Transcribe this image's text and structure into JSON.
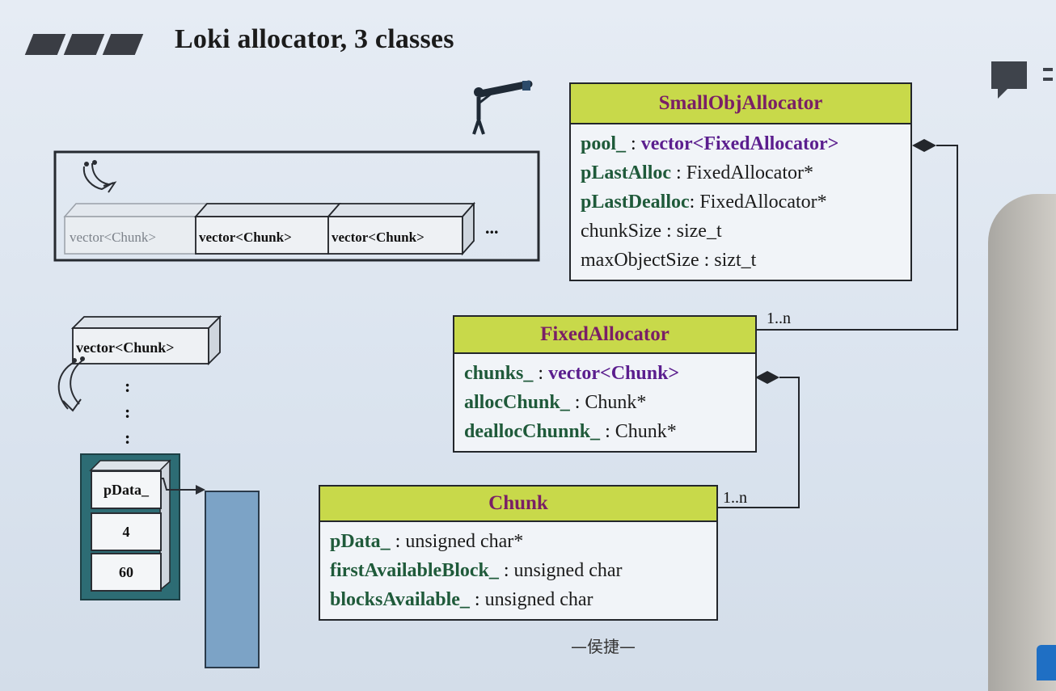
{
  "slide": {
    "title": "Loki allocator, 3 classes",
    "author_mark": "—侯捷—"
  },
  "classes": {
    "small_obj_allocator": {
      "name": "SmallObjAllocator",
      "attributes": [
        {
          "name": "pool_",
          "sep": " : ",
          "type": "vector<FixedAllocator>"
        },
        {
          "name": "pLastAlloc",
          "sep": " : ",
          "type": "FixedAllocator*"
        },
        {
          "name": "pLastDealloc",
          "sep": ": ",
          "type": "FixedAllocator*"
        },
        {
          "name": "",
          "sep": "",
          "type": "chunkSize : size_t"
        },
        {
          "name": "",
          "sep": "",
          "type": "maxObjectSize : sizt_t"
        }
      ]
    },
    "fixed_allocator": {
      "name": "FixedAllocator",
      "attributes": [
        {
          "name": "chunks_",
          "sep": " : ",
          "type": "vector<Chunk>"
        },
        {
          "name": "allocChunk_",
          "sep": " : ",
          "type": "Chunk*"
        },
        {
          "name": "deallocChunnk_",
          "sep": " : ",
          "type": "Chunk*"
        }
      ]
    },
    "chunk": {
      "name": "Chunk",
      "attributes": [
        {
          "name": "pData_",
          "sep": " : ",
          "type": "unsigned char*"
        },
        {
          "name": "firstAvailableBlock_",
          "sep": " : ",
          "type": "unsigned char"
        },
        {
          "name": "blocksAvailable_",
          "sep": " : ",
          "type": "unsigned char"
        }
      ]
    }
  },
  "multiplicities": {
    "pool_to_fixed": "1..n",
    "chunks_to_chunk": "1..n"
  },
  "top_vector_row": {
    "cells": [
      "vector<Chunk>",
      "vector<Chunk>",
      "vector<Chunk>"
    ],
    "ellipsis": "..."
  },
  "left_stack": {
    "vector_label": "vector<Chunk>",
    "dots": [
      ":",
      ":",
      ":"
    ],
    "cells": [
      "pData_",
      "4",
      "60"
    ]
  }
}
